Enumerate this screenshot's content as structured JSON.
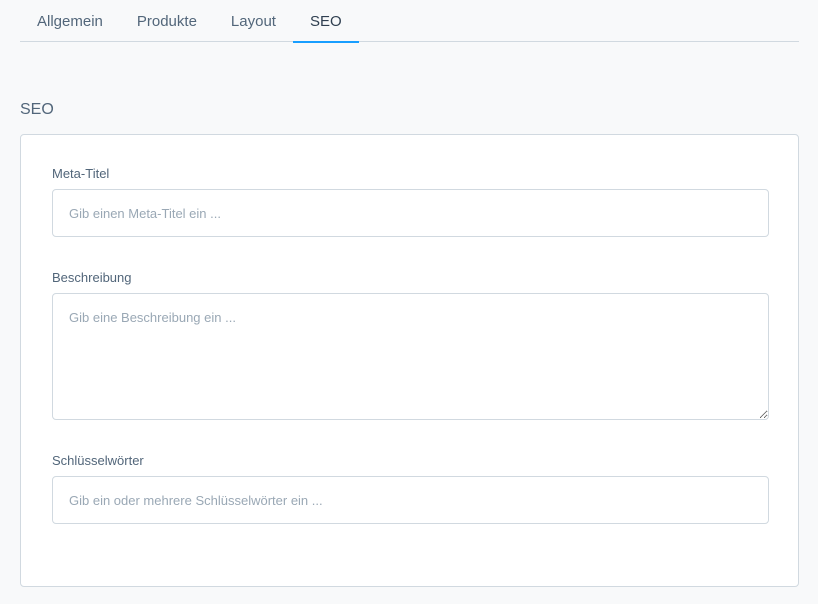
{
  "tabs": [
    {
      "label": "Allgemein",
      "active": false
    },
    {
      "label": "Produkte",
      "active": false
    },
    {
      "label": "Layout",
      "active": false
    },
    {
      "label": "SEO",
      "active": true
    }
  ],
  "section": {
    "title": "SEO"
  },
  "fields": {
    "meta_title": {
      "label": "Meta-Titel",
      "placeholder": "Gib einen Meta-Titel ein ...",
      "value": ""
    },
    "description": {
      "label": "Beschreibung",
      "placeholder": "Gib eine Beschreibung ein ...",
      "value": ""
    },
    "keywords": {
      "label": "Schlüsselwörter",
      "placeholder": "Gib ein oder mehrere Schlüsselwörter ein ...",
      "value": ""
    }
  },
  "colors": {
    "accent": "#189eff",
    "border": "#d1d9e0",
    "text": "#52667a",
    "placeholder": "#9aa8b5",
    "background": "#f8f9fa"
  }
}
